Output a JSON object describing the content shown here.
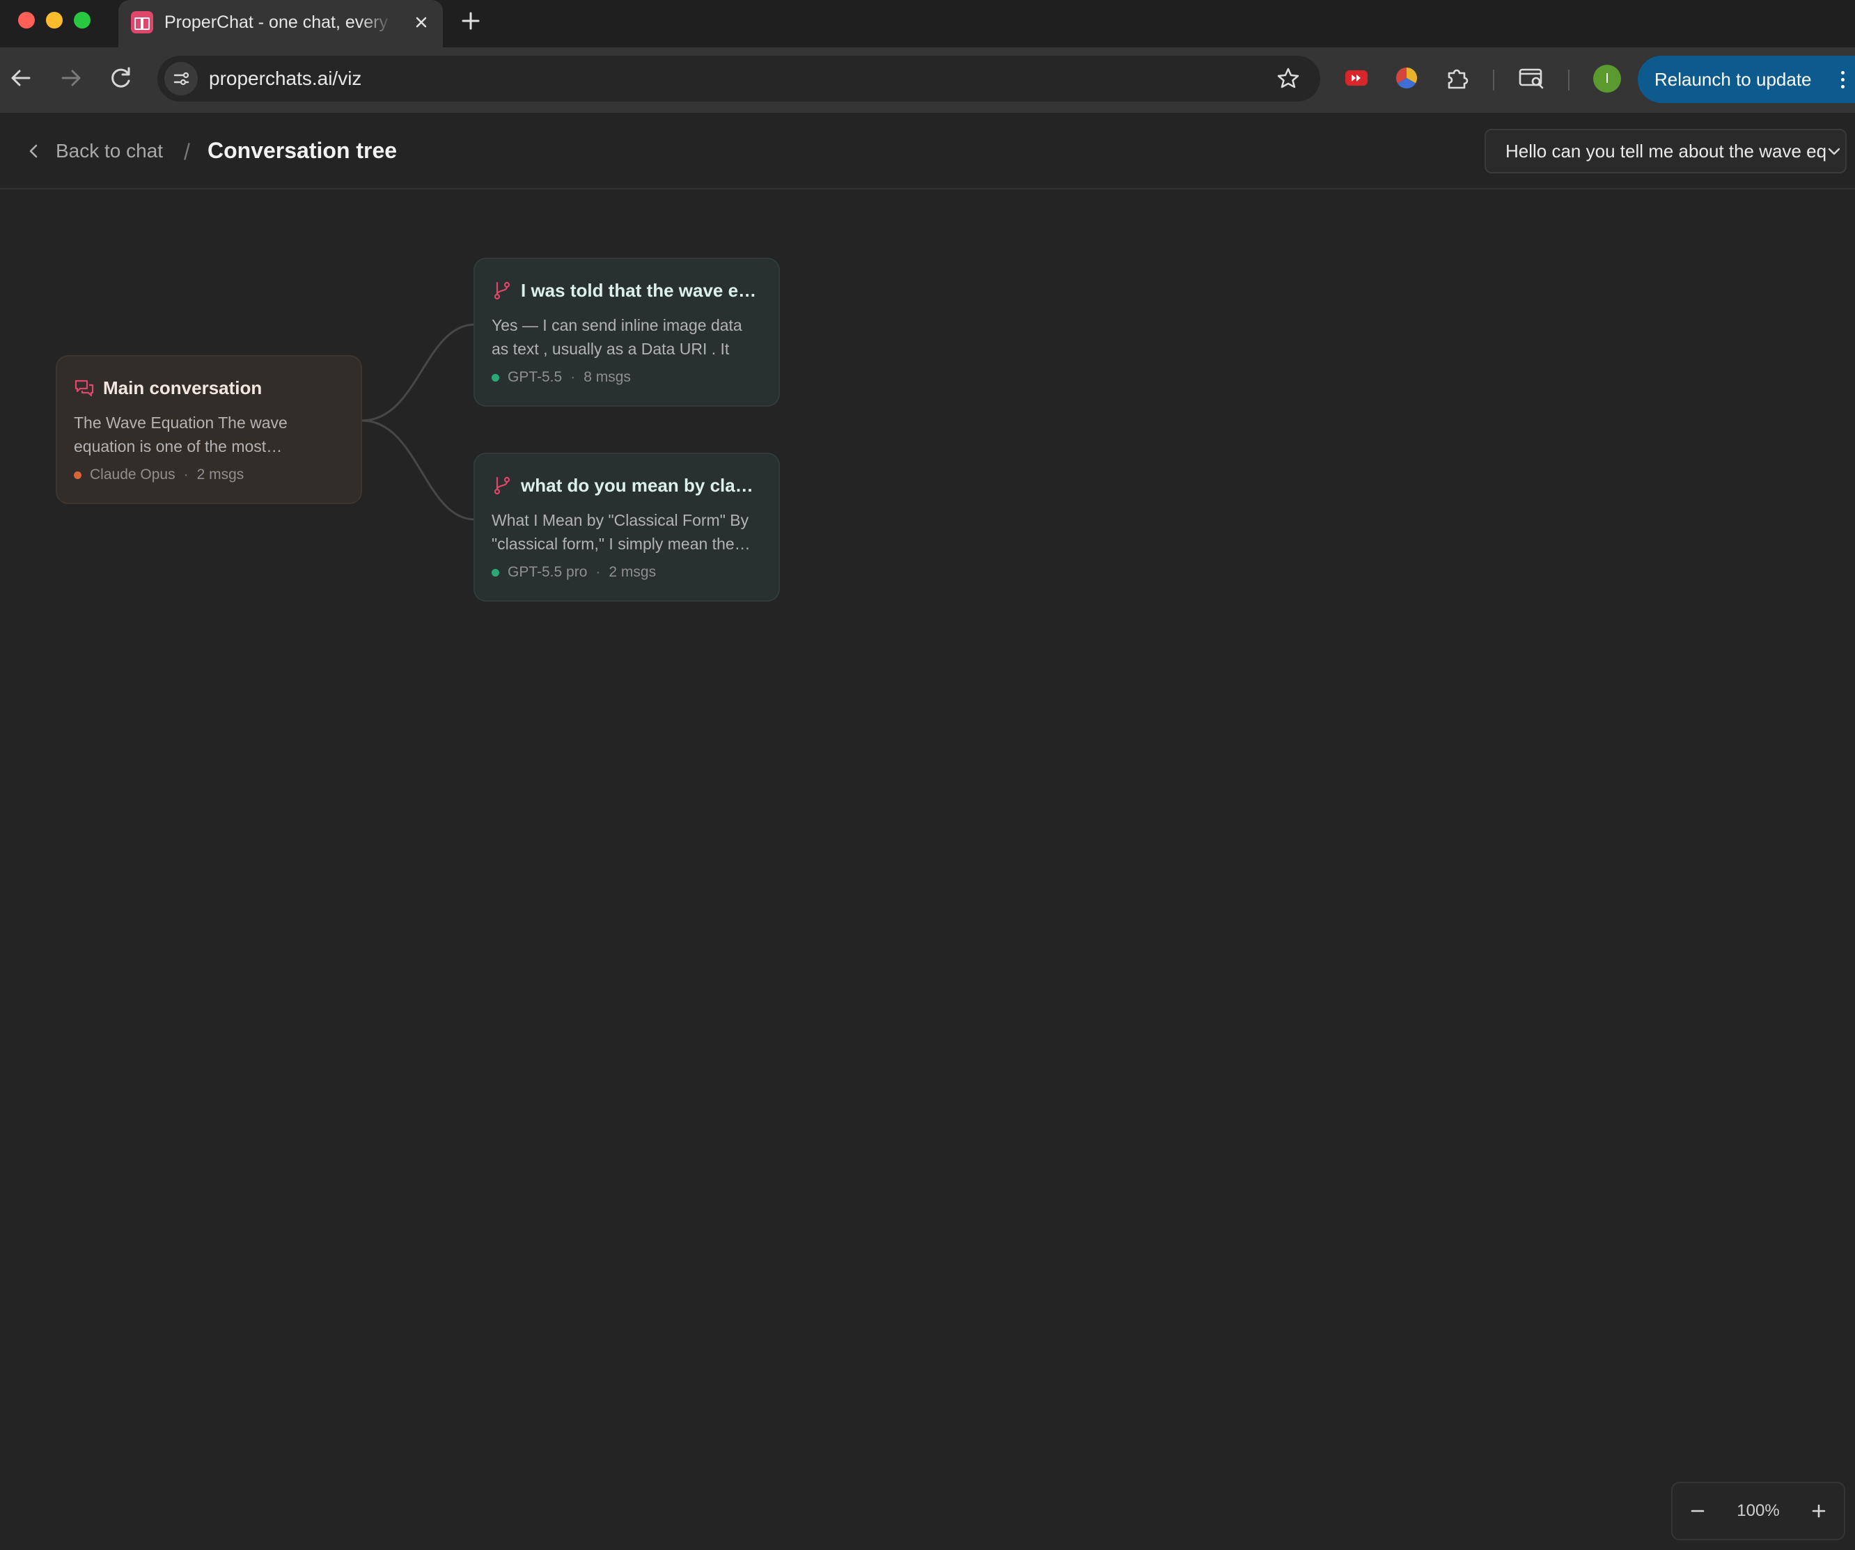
{
  "browser": {
    "tab_title": "ProperChat - one chat, every",
    "url": "properchats.ai/viz",
    "profile_initial": "I",
    "relaunch_label": "Relaunch to update"
  },
  "header": {
    "back_label": "Back to chat",
    "separator": "/",
    "title": "Conversation tree",
    "conversation_select": "Hello can you tell me about the wave equation"
  },
  "tree": {
    "main": {
      "title": "Main conversation",
      "preview": "The Wave Equation The wave equation is one of the most fundamental equations",
      "model": "Claude Opus",
      "dot_color": "#d9653b",
      "messages": "2 msgs"
    },
    "branches": [
      {
        "title": "I was told that the wave equation",
        "preview": "Yes — I can send inline image data as text , usually as a Data URI . It",
        "model": "GPT-5.5",
        "dot_color": "#2ba876",
        "messages": "8 msgs"
      },
      {
        "title": "what do you mean by classical form",
        "preview": "What I Mean by \"Classical Form\" By \"classical form,\" I simply mean the form",
        "model": "GPT-5.5 pro",
        "dot_color": "#2ba876",
        "messages": "2 msgs"
      }
    ],
    "meta_separator": "·"
  },
  "zoom": {
    "level": "100%",
    "minus_icon": "minus-icon",
    "plus_icon": "plus-icon"
  },
  "colors": {
    "background": "#242424",
    "main_node": "#332d2a",
    "branch_node": "#283030",
    "accent": "#e0456a",
    "relaunch": "#0d5a8e"
  }
}
